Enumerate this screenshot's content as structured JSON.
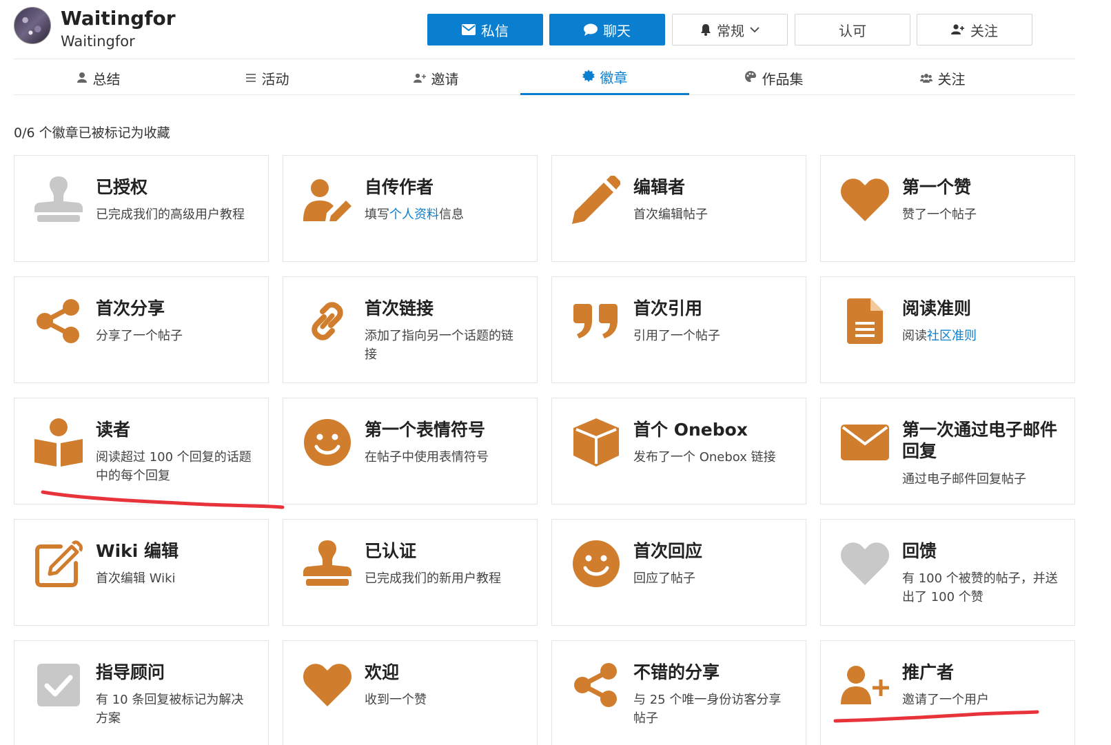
{
  "colors": {
    "primary": "#0a7fd0",
    "badge_bronze": "#d07d2e",
    "badge_gray": "#c8c8c8",
    "annotation": "#e8333b"
  },
  "user": {
    "display_name": "Waitingfor",
    "username": "Waitingfor"
  },
  "actions": {
    "message": "私信",
    "chat": "聊天",
    "notification_level": "常规",
    "approve": "认可",
    "follow": "关注"
  },
  "tabs": [
    {
      "label": "总结",
      "icon": "user-icon"
    },
    {
      "label": "活动",
      "icon": "stream-icon"
    },
    {
      "label": "邀请",
      "icon": "user-plus-icon"
    },
    {
      "label": "徽章",
      "icon": "certificate-icon",
      "active": true
    },
    {
      "label": "作品集",
      "icon": "palette-icon"
    },
    {
      "label": "关注",
      "icon": "users-icon"
    }
  ],
  "summary": "0/6 个徽章已被标记为收藏",
  "badges": [
    {
      "title": "已授权",
      "desc": "已完成我们的高级用户教程",
      "icon": "stamp-icon",
      "color": "gray"
    },
    {
      "title": "自传作者",
      "desc_pre": "填写",
      "desc_link": "个人资料",
      "desc_post": "信息",
      "icon": "user-pen-icon",
      "color": "bronze"
    },
    {
      "title": "编辑者",
      "desc": "首次编辑帖子",
      "icon": "pencil-icon",
      "color": "bronze"
    },
    {
      "title": "第一个赞",
      "desc": "赞了一个帖子",
      "icon": "heart-icon",
      "color": "bronze"
    },
    {
      "title": "首次分享",
      "desc": "分享了一个帖子",
      "icon": "share-icon",
      "color": "bronze"
    },
    {
      "title": "首次链接",
      "desc": "添加了指向另一个话题的链接",
      "icon": "link-icon",
      "color": "bronze"
    },
    {
      "title": "首次引用",
      "desc": "引用了一个帖子",
      "icon": "quote-icon",
      "color": "bronze"
    },
    {
      "title": "阅读准则",
      "desc_pre": "阅读",
      "desc_link": "社区准则",
      "desc_post": "",
      "icon": "file-lines-icon",
      "color": "bronze"
    },
    {
      "title": "读者",
      "desc": "阅读超过 100 个回复的话题中的每个回复",
      "icon": "book-reader-icon",
      "color": "bronze"
    },
    {
      "title": "第一个表情符号",
      "desc": "在帖子中使用表情符号",
      "icon": "smile-icon",
      "color": "bronze"
    },
    {
      "title": "首个 Onebox",
      "desc": "发布了一个 Onebox 链接",
      "icon": "cube-icon",
      "color": "bronze"
    },
    {
      "title": "第一次通过电子邮件回复",
      "desc": "通过电子邮件回复帖子",
      "icon": "envelope-icon",
      "color": "bronze"
    },
    {
      "title": "Wiki 编辑",
      "desc": "首次编辑 Wiki",
      "icon": "pen-square-icon",
      "color": "bronze"
    },
    {
      "title": "已认证",
      "desc": "已完成我们的新用户教程",
      "icon": "stamp-icon",
      "color": "bronze"
    },
    {
      "title": "首次回应",
      "desc": "回应了帖子",
      "icon": "smile-icon",
      "color": "bronze"
    },
    {
      "title": "回馈",
      "desc": "有 100 个被赞的帖子，并送出了 100 个赞",
      "icon": "heart-icon",
      "color": "gray"
    },
    {
      "title": "指导顾问",
      "desc": "有 10 条回复被标记为解决方案",
      "icon": "check-square-icon",
      "color": "gray"
    },
    {
      "title": "欢迎",
      "desc": "收到一个赞",
      "icon": "heart-icon",
      "color": "bronze"
    },
    {
      "title": "不错的分享",
      "desc": "与 25 个唯一身份访客分享帖子",
      "icon": "share-icon",
      "color": "bronze"
    },
    {
      "title": "推广者",
      "desc": "邀请了一个用户",
      "icon": "user-plus-icon",
      "color": "bronze"
    }
  ]
}
